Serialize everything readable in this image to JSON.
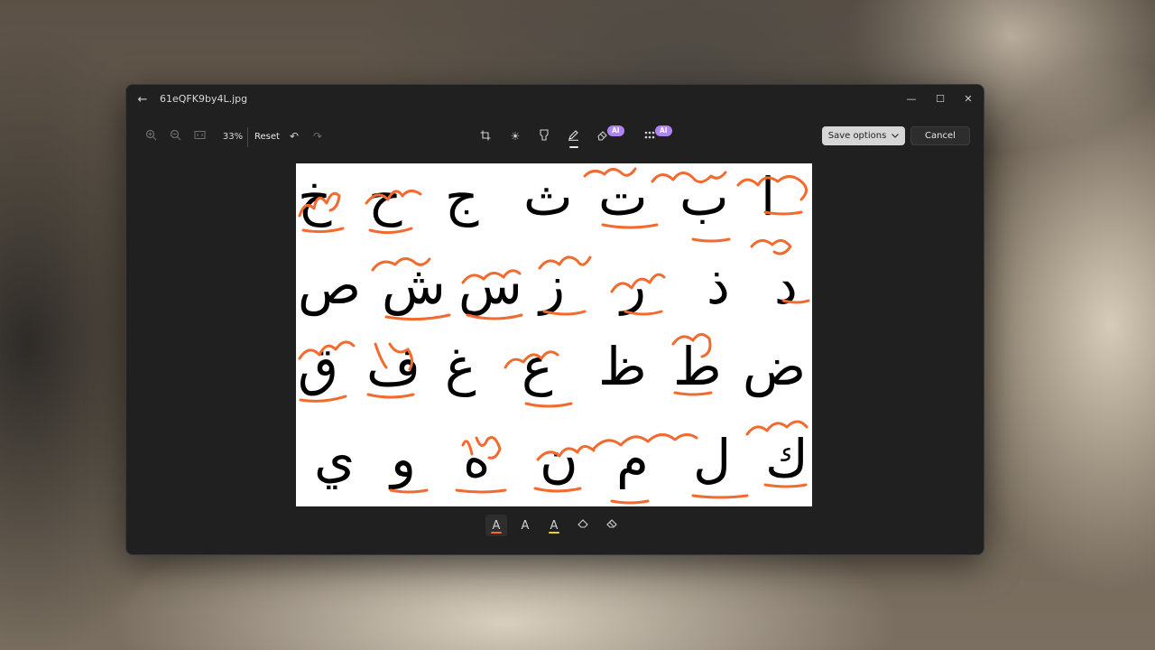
{
  "window": {
    "title": "61eQFK9by4L.jpg",
    "back_icon": "arrow-left-icon",
    "controls": [
      "minimize-icon",
      "maximize-icon",
      "close-icon"
    ]
  },
  "toolbar": {
    "zoom_in_icon": "zoom-in-icon",
    "zoom_out_icon": "zoom-out-icon",
    "fit_icon": "fit-to-window-icon",
    "zoom_level": "33%",
    "reset_label": "Reset",
    "undo_icon": "undo-icon",
    "redo_icon": "redo-icon",
    "edit_tools": [
      {
        "icon": "crop-icon"
      },
      {
        "icon": "brightness-icon"
      },
      {
        "icon": "filter-icon"
      },
      {
        "icon": "markup-pen-icon",
        "active": true
      },
      {
        "icon": "generative-erase-icon",
        "badge": "AI"
      },
      {
        "icon": "background-blur-icon",
        "badge": "AI"
      }
    ],
    "save_label": "Save options",
    "cancel_label": "Cancel"
  },
  "image": {
    "letters": [
      [
        "خ",
        "ح",
        "ج",
        "ث",
        "ت",
        "ب",
        "ا"
      ],
      [
        "ص",
        "ش",
        "س",
        "ز",
        "ر",
        "ذ",
        "د"
      ],
      [
        "ق",
        "ف",
        "غ",
        "ع",
        "ظ",
        "ط",
        "ض"
      ],
      [
        "ي",
        "و",
        "ه",
        "ن",
        "م",
        "ل",
        "ك"
      ]
    ],
    "annotation_color": "#f26a2e"
  },
  "markup": {
    "tools": [
      {
        "icon": "ballpoint-pen-icon",
        "swatch": "#f26a2e",
        "selected": true
      },
      {
        "icon": "pencil-icon",
        "swatch": ""
      },
      {
        "icon": "highlighter-icon",
        "swatch": "#e7d42c"
      },
      {
        "icon": "eraser-icon",
        "swatch": ""
      },
      {
        "icon": "erase-all-icon",
        "swatch": ""
      }
    ]
  }
}
